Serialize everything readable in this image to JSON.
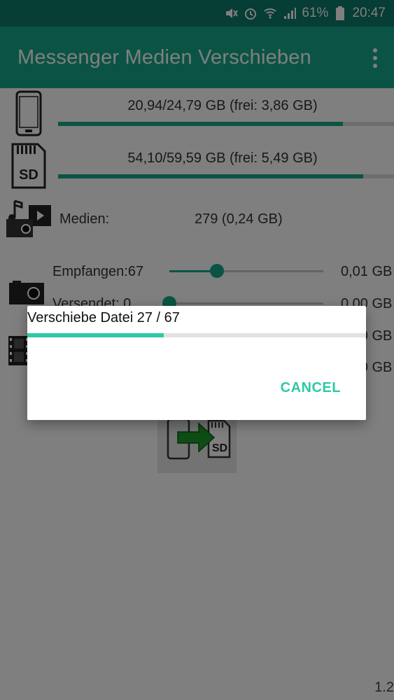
{
  "status_bar": {
    "battery": "61%",
    "time": "20:47",
    "icons": [
      "mute-icon",
      "alarm-icon",
      "wifi-icon",
      "signal-icon",
      "battery-icon"
    ]
  },
  "app_bar": {
    "title": "Messenger Medien Verschieben",
    "menu_icon": "more-vert-icon"
  },
  "storage": {
    "internal": {
      "text": "20,94/24,79 GB (frei: 3,86 GB)",
      "used_fraction": 0.847,
      "icon": "phone-icon"
    },
    "sd": {
      "text": "54,10/59,59 GB (frei: 5,49 GB)",
      "used_fraction": 0.908,
      "icon": "sd-card-icon",
      "icon_label": "SD"
    }
  },
  "media": {
    "label": "Medien:",
    "value": "279 (0,24 GB)",
    "icon": "media-icon"
  },
  "photos": {
    "icon": "camera-icon",
    "rows": [
      {
        "label": "Empfangen:67",
        "value": "0,01 GB",
        "slider_fraction": 0.31
      },
      {
        "label": "Versendet: 0",
        "value": "0,00 GB",
        "slider_fraction": 0.0
      }
    ]
  },
  "videos": {
    "icon": "video-icon",
    "rows": [
      {
        "value": "0,00 GB"
      },
      {
        "value": "0,00 GB"
      }
    ]
  },
  "move_button": {
    "icon": "move-to-sd-icon",
    "icon_label": "SD"
  },
  "version": "1.2",
  "dialog": {
    "message": "Verschiebe Datei 27 / 67",
    "progress_current": 27,
    "progress_total": 67,
    "cancel_label": "CANCEL"
  },
  "colors": {
    "accent": "#17a88a",
    "status_bar": "#0d7a68",
    "dialog_accent": "#2ec9a6"
  }
}
